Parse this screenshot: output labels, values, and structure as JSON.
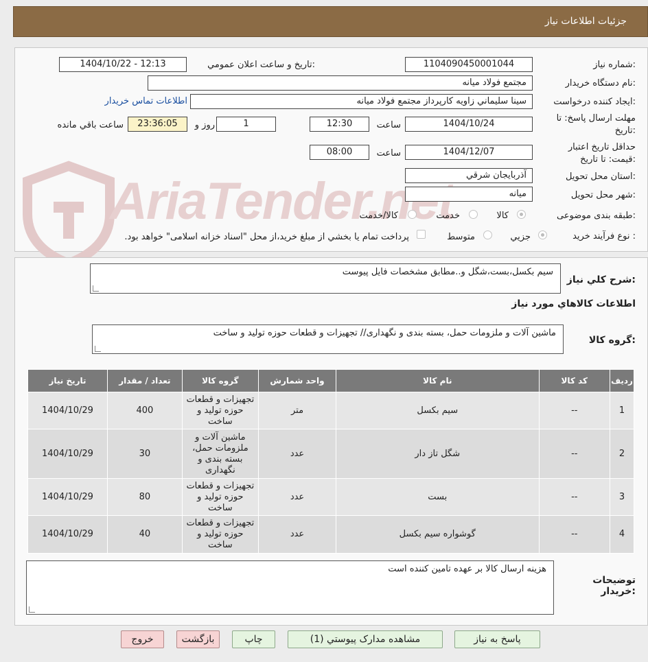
{
  "header": {
    "title": "جزئیات اطلاعات نیاز"
  },
  "form": {
    "need_number_label": "شماره نیاز:",
    "need_number": "1104090450001044",
    "announce_label": "تاریخ و ساعت اعلان عمومي:",
    "announce_value": "1404/10/22 - 12:13",
    "buyer_org_label": "نام دستگاه خريدار:",
    "buyer_org": "مجتمع فولاد ميانه",
    "requester_label": "ايجاد کننده درخواست:",
    "requester": "سينا سليماني زاويه کارپرداز مجتمع فولاد ميانه",
    "contact_link": "اطلاعات تماس خريدار",
    "deadline_label": "مهلت ارسال پاسخ: تا تاريخ:",
    "deadline_date": "1404/10/24",
    "time_label": "ساعت",
    "deadline_time": "12:30",
    "days_value": "1",
    "days_label": "روز و",
    "remaining_time": "23:36:05",
    "remaining_label": "ساعت باقي مانده",
    "validity_label": "حداقل تاريخ اعتبار قيمت: تا تاريخ:",
    "validity_date": "1404/12/07",
    "validity_time": "08:00",
    "province_label": "استان محل تحويل:",
    "province": "آذربايجان شرقي",
    "city_label": "شهر محل تحويل:",
    "city": "ميانه",
    "category_label": "طبقه بندی موضوعی:",
    "category_options": [
      "کالا",
      "خدمت",
      "کالا/خدمت"
    ],
    "category_selected": "کالا",
    "process_label": "نوع فرآيند خريد :",
    "process_options": [
      "جزيي",
      "متوسط"
    ],
    "process_selected": "جزيي",
    "payment_note": "پرداخت تمام يا بخشي از مبلغ خريد،از محل \"اسناد خزانه اسلامی\" خواهد بود."
  },
  "details": {
    "summary_label": "شرح کلي نياز:",
    "summary": "سيم بکسل،بست،شگل و..مطابق مشخصات فايل پيوست",
    "goods_info_title": "اطلاعات کالاهاي مورد نياز",
    "group_label": "گروه کالا:",
    "group_value": "ماشين آلات و ملزومات حمل، بسته بندی و نگهداری// تجهيزات و قطعات حوزه توليد و ساخت"
  },
  "table": {
    "headers": [
      "رديف",
      "کد کالا",
      "نام کالا",
      "واحد شمارش",
      "گروه کالا",
      "تعداد / مقدار",
      "تاريخ نياز"
    ],
    "rows": [
      [
        "1",
        "--",
        "سيم بکسل",
        "متر",
        "تجهيزات و قطعات حوزه توليد و ساخت",
        "400",
        "1404/10/29"
      ],
      [
        "2",
        "--",
        "شگل تاز دار",
        "عدد",
        "ماشين آلات و ملزومات حمل، بسته بندی و نگهداری",
        "30",
        "1404/10/29"
      ],
      [
        "3",
        "--",
        "بست",
        "عدد",
        "تجهيزات و قطعات حوزه توليد و ساخت",
        "80",
        "1404/10/29"
      ],
      [
        "4",
        "--",
        "گوشواره سيم بکسل",
        "عدد",
        "تجهيزات و قطعات حوزه توليد و ساخت",
        "40",
        "1404/10/29"
      ]
    ]
  },
  "notes": {
    "label": "توضيحات خريدار:",
    "value": "هزينه ارسال کالا بر عهده تامين کننده است"
  },
  "buttons": {
    "reply": "پاسخ به نياز",
    "attachments": "مشاهده مدارک پيوستي (1)",
    "print": "چاپ",
    "back": "بازگشت",
    "exit": "خروج"
  },
  "watermark": {
    "text": "AriaTender.net"
  },
  "colors": {
    "header_bg": "#8b6b45",
    "table_header": "#7a7a7a",
    "link": "#1a4fa0"
  }
}
